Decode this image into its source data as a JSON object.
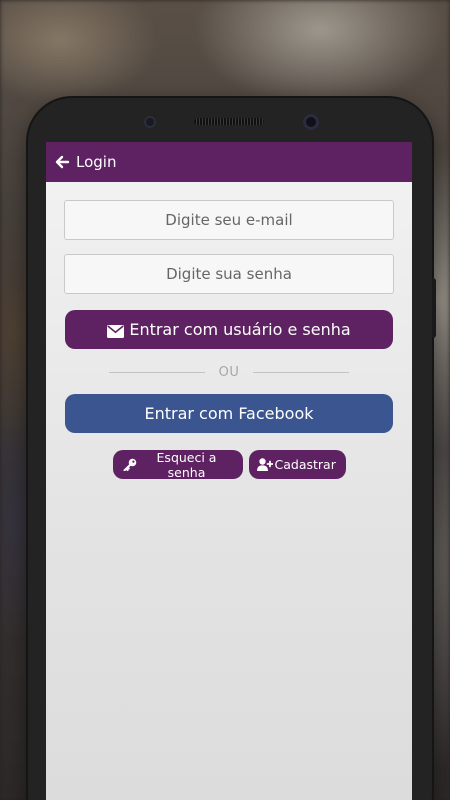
{
  "app_bar": {
    "title": "Login",
    "icon": "arrow-left-icon"
  },
  "form": {
    "email_placeholder": "Digite seu e-mail",
    "password_placeholder": "Digite sua senha",
    "login_button_label": "Entrar com usuário e senha",
    "login_button_icon": "envelope-icon",
    "divider_text": "OU",
    "facebook_button_label": "Entrar com Facebook",
    "forgot_label": "Esqueci a senha",
    "forgot_icon": "key-icon",
    "register_label": "Cadastrar",
    "register_icon": "user-plus-icon"
  },
  "colors": {
    "primary": "#5e2262",
    "facebook": "#3b5590",
    "screen_bg": "#e6e6e6"
  }
}
